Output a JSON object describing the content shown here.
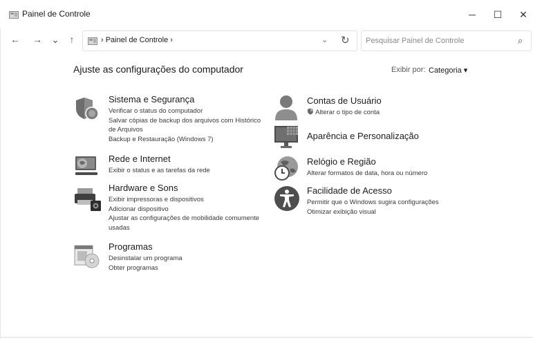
{
  "window": {
    "title": "Painel de Controle",
    "min_icon": "─",
    "max_icon": "☐",
    "close_icon": "✕"
  },
  "nav": {
    "back": "←",
    "forward": "→",
    "recent": "⌄",
    "up": "↑",
    "address": "› Painel de Controle ›",
    "dropdown": "⌄",
    "refresh": "↻",
    "search_placeholder": "Pesquisar Painel de Controle",
    "search_icon": "⌕"
  },
  "main": {
    "heading": "Ajuste as configurações do computador",
    "view_by_label": "Exibir por:",
    "view_by_value": "Categoria ▾"
  },
  "categories": {
    "system": {
      "title": "Sistema e Segurança",
      "links": [
        "Verificar o status do computador",
        "Salvar cópias de backup dos arquivos com Histórico",
        "de Arquivos",
        "Backup e Restauração (Windows 7)"
      ]
    },
    "network": {
      "title": "Rede e Internet",
      "links": [
        "Exibir o status e as tarefas da rede"
      ]
    },
    "hardware": {
      "title": "Hardware e Sons",
      "links": [
        "Exibir impressoras e dispositivos",
        "Adicionar dispositivo",
        "Ajustar as configurações de mobilidade comumente",
        "usadas"
      ]
    },
    "programs": {
      "title": "Programas",
      "links": [
        "Desinstalar um programa",
        "Obter programas"
      ]
    },
    "users": {
      "title": "Contas de Usuário",
      "links": [
        "Alterar o tipo de conta"
      ]
    },
    "appearance": {
      "title": "Aparência e Personalização",
      "links": []
    },
    "clock": {
      "title": "Relógio e Região",
      "links": [
        "Alterar formatos de data, hora ou número"
      ]
    },
    "access": {
      "title": "Facilidade de Acesso",
      "links": [
        "Permitir que o Windows sugira configurações",
        "Otimizar exibição visual"
      ]
    }
  }
}
